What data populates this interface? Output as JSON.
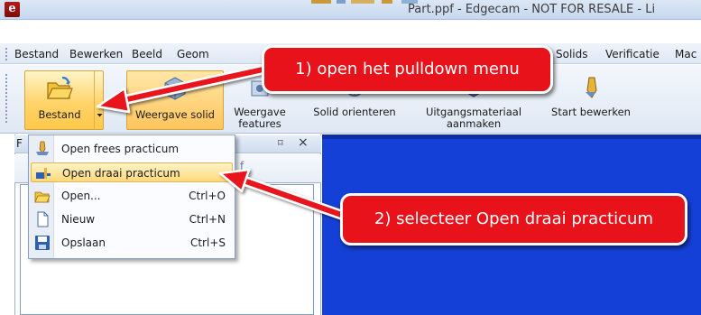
{
  "window": {
    "logo_letter": "e",
    "title": "Part.ppf - Edgecam - NOT FOR RESALE - Li"
  },
  "menubar": {
    "items": [
      "Bestand",
      "Bewerken",
      "Beeld",
      "Geom",
      "Solids",
      "Verificatie",
      "Mac"
    ]
  },
  "toolbar": {
    "buttons": [
      {
        "label": "Bestand",
        "icon": "open-folder-icon"
      },
      {
        "label": "Weergave solid",
        "icon": "solid-cube-icon"
      },
      {
        "label": "Weergave\nfeatures",
        "icon": "features-icon"
      },
      {
        "label": "Solid orienteren",
        "icon": "orient-icon"
      },
      {
        "label": "Uitgangsmateriaal\naanmaken",
        "icon": "stock-icon"
      },
      {
        "label": "Start bewerken",
        "icon": "machining-icon"
      }
    ]
  },
  "panel": {
    "header_letter": "F",
    "pin_glyph": "⌑",
    "close_glyph": "×",
    "sub_letter": "f"
  },
  "dropdown": {
    "items": [
      {
        "label": "Open frees practicum",
        "shortcut": "",
        "icon": "milling-icon"
      },
      {
        "label": "Open draai practicum",
        "shortcut": "",
        "icon": "turning-icon",
        "highlighted": true
      },
      {
        "label": "Open...",
        "shortcut": "Ctrl+O",
        "icon": "open-folder-icon"
      },
      {
        "label": "Nieuw",
        "shortcut": "Ctrl+N",
        "icon": "new-document-icon"
      },
      {
        "label": "Opslaan",
        "shortcut": "Ctrl+S",
        "icon": "save-disk-icon"
      }
    ]
  },
  "annotations": {
    "step1": "1) open het pulldown menu",
    "step2": "2) selecteer Open draai practicum"
  },
  "colors": {
    "callout_red": "#e8131a",
    "viewport_blue": "#1540d8",
    "highlight_orange": "#ffd36a"
  }
}
